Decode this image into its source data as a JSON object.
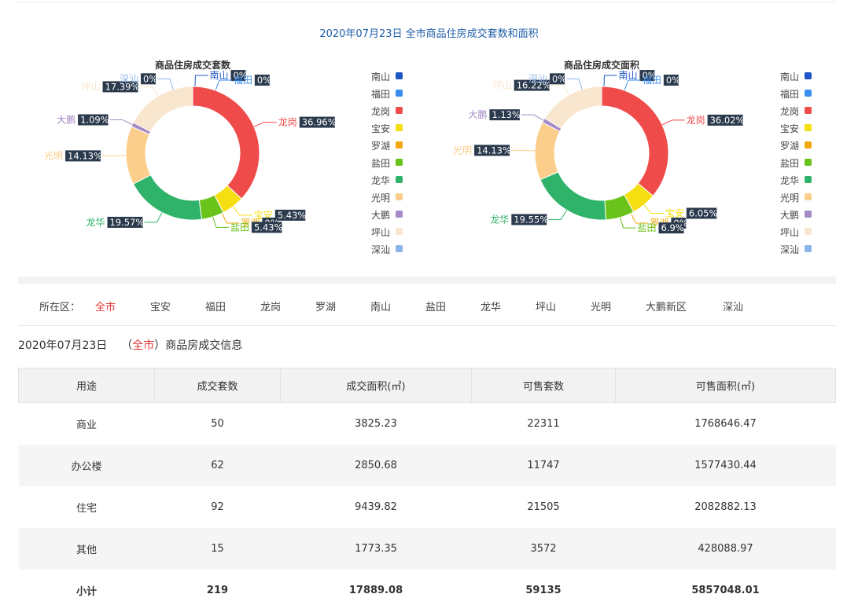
{
  "main_title": "2020年07月23日 全市商品住房成交套数和面积",
  "legend_items": [
    {
      "name": "南山",
      "color": "#1f55c4"
    },
    {
      "name": "福田",
      "color": "#3a8ef0"
    },
    {
      "name": "龙岗",
      "color": "#f04b4b"
    },
    {
      "name": "宝安",
      "color": "#f5df10"
    },
    {
      "name": "罗湖",
      "color": "#f2a80c"
    },
    {
      "name": "盐田",
      "color": "#6ac31a"
    },
    {
      "name": "龙华",
      "color": "#2fb36a"
    },
    {
      "name": "光明",
      "color": "#fbcf8b"
    },
    {
      "name": "大鹏",
      "color": "#a58ac6"
    },
    {
      "name": "坪山",
      "color": "#f8e6cf"
    },
    {
      "name": "深汕",
      "color": "#8db4e8"
    }
  ],
  "chart_data": [
    {
      "type": "pie",
      "title": "商品住房成交套数",
      "slices": [
        {
          "name": "南山",
          "value": 0,
          "label": "0%"
        },
        {
          "name": "福田",
          "value": 0,
          "label": "0%"
        },
        {
          "name": "龙岗",
          "value": 36.96,
          "label": "36.96%"
        },
        {
          "name": "宝安",
          "value": 5.43,
          "label": "5.43%"
        },
        {
          "name": "罗湖",
          "value": 0,
          "label": "0%"
        },
        {
          "name": "盐田",
          "value": 5.43,
          "label": "5.43%"
        },
        {
          "name": "龙华",
          "value": 19.57,
          "label": "19.57%"
        },
        {
          "name": "光明",
          "value": 14.13,
          "label": "14.13%"
        },
        {
          "name": "大鹏",
          "value": 1.09,
          "label": "1.09%"
        },
        {
          "name": "坪山",
          "value": 17.39,
          "label": "17.39%"
        },
        {
          "name": "深汕",
          "value": 0,
          "label": "0%"
        }
      ],
      "legend": "right"
    },
    {
      "type": "pie",
      "title": "商品住房成交面积",
      "slices": [
        {
          "name": "南山",
          "value": 0,
          "label": "0%"
        },
        {
          "name": "福田",
          "value": 0,
          "label": "0%"
        },
        {
          "name": "龙岗",
          "value": 36.02,
          "label": "36.02%"
        },
        {
          "name": "宝安",
          "value": 6.05,
          "label": "6.05%"
        },
        {
          "name": "罗湖",
          "value": 0,
          "label": "0%"
        },
        {
          "name": "盐田",
          "value": 6.9,
          "label": "6.9%"
        },
        {
          "name": "龙华",
          "value": 19.55,
          "label": "19.55%"
        },
        {
          "name": "光明",
          "value": 14.13,
          "label": "14.13%"
        },
        {
          "name": "大鹏",
          "value": 1.13,
          "label": "1.13%"
        },
        {
          "name": "坪山",
          "value": 16.22,
          "label": "16.22%"
        },
        {
          "name": "深汕",
          "value": 0,
          "label": "0%"
        }
      ],
      "legend": "right"
    }
  ],
  "district_filter": {
    "label": "所在区：",
    "items": [
      "全市",
      "宝安",
      "福田",
      "龙岗",
      "罗湖",
      "南山",
      "盐田",
      "龙华",
      "坪山",
      "光明",
      "大鹏新区",
      "深汕"
    ],
    "active": "全市"
  },
  "info": {
    "date": "2020年07月23日",
    "open": "（",
    "area": "全市",
    "close": "）商品房成交信息"
  },
  "table": {
    "headers": [
      "用途",
      "成交套数",
      "成交面积(㎡)",
      "可售套数",
      "可售面积(㎡)"
    ],
    "rows": [
      [
        "商业",
        "50",
        "3825.23",
        "22311",
        "1768646.47"
      ],
      [
        "办公楼",
        "62",
        "2850.68",
        "11747",
        "1577430.44"
      ],
      [
        "住宅",
        "92",
        "9439.82",
        "21505",
        "2082882.13"
      ],
      [
        "其他",
        "15",
        "1773.35",
        "3572",
        "428088.97"
      ]
    ],
    "total": [
      "小计",
      "219",
      "17889.08",
      "59135",
      "5857048.01"
    ]
  }
}
